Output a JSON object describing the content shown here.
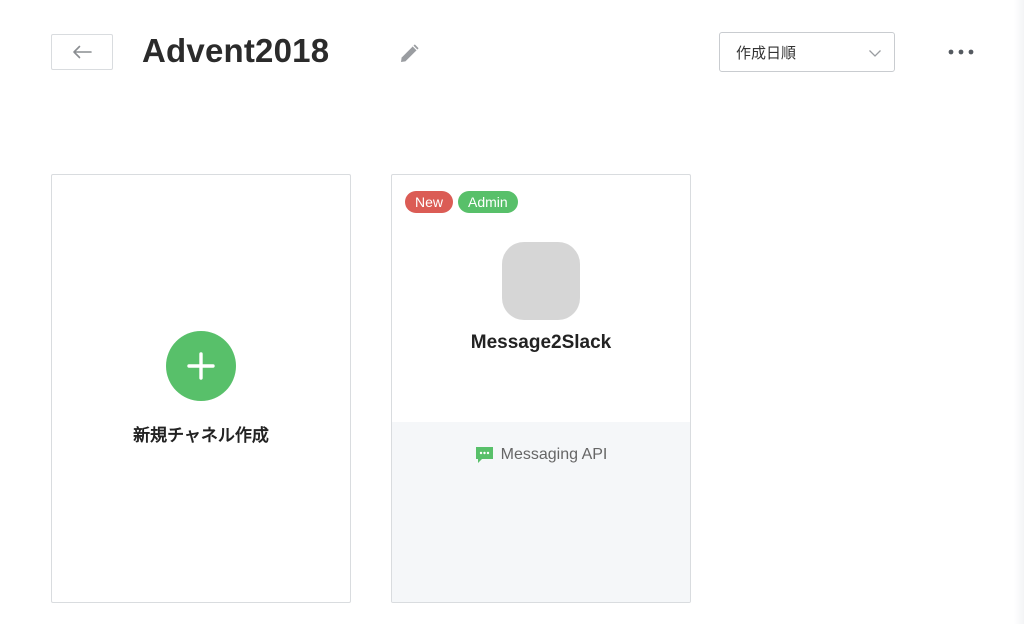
{
  "header": {
    "back_icon": "arrow-left-icon",
    "title": "Advent2018",
    "edit_icon": "pencil-icon",
    "sort": {
      "selected": "作成日順",
      "icon": "chevron-down-icon"
    },
    "more_icon": "ellipsis-icon"
  },
  "cards": {
    "new_channel": {
      "icon": "plus-icon",
      "label": "新規チャネル作成"
    },
    "channel": {
      "badges": [
        "New",
        "Admin"
      ],
      "name": "Message2Slack",
      "type_icon": "chat-bubble-icon",
      "type_label": "Messaging API"
    }
  },
  "colors": {
    "accent_green": "#58c06a",
    "badge_red": "#db5c55",
    "footer_bg": "#f5f7f9"
  }
}
